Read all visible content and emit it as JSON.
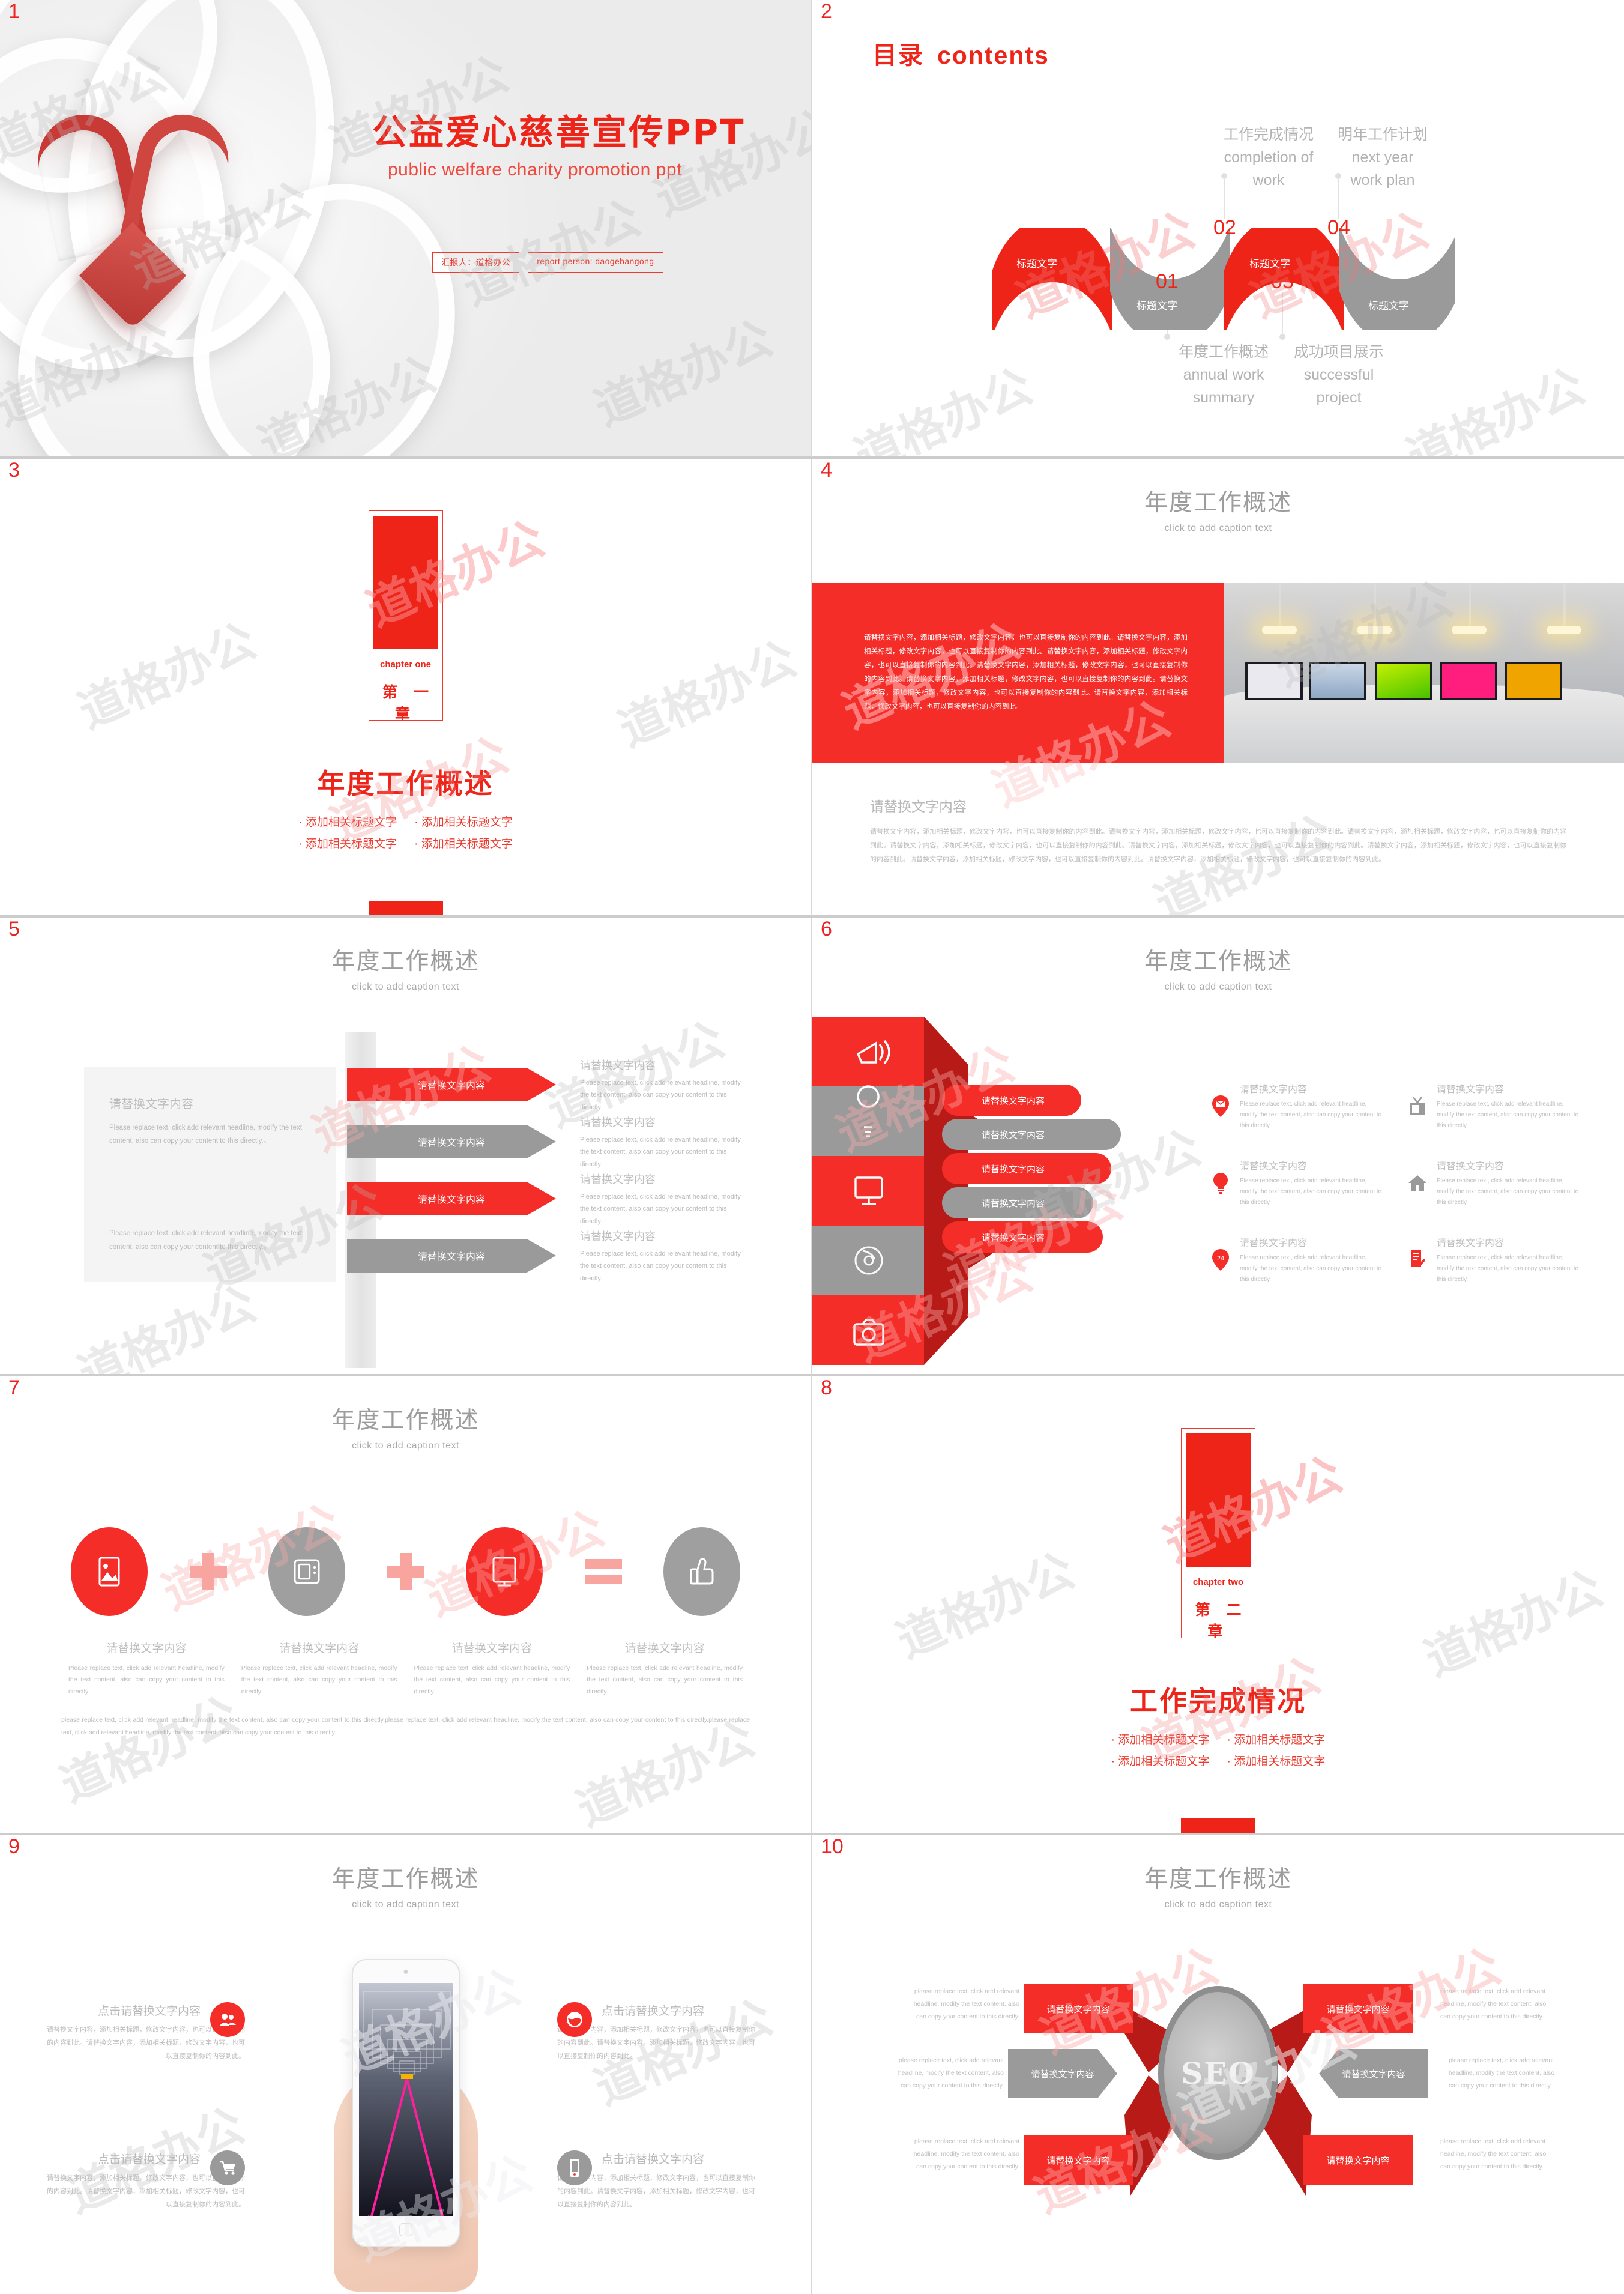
{
  "theme": {
    "red": "#f52d28",
    "red_dark": "#ee2419",
    "gray": "#9a9a9a",
    "light_gray": "#bfbfbf"
  },
  "watermark": "道格办公",
  "slides": [
    {
      "num": "1",
      "title_cn": "公益爱心慈善宣传PPT",
      "title_en": "public welfare charity promotion ppt",
      "badge_cn": "汇报人：道格办公",
      "badge_en": "report person: daogebangong"
    },
    {
      "num": "2",
      "title_cn": "目录",
      "title_en": "contents",
      "segments": [
        {
          "number": "01",
          "ribbon_label": "标题文字",
          "title_cn": "年度工作概述",
          "title_en_1": "annual work",
          "title_en_2": "summary",
          "color": "red",
          "pos": "down"
        },
        {
          "number": "02",
          "ribbon_label": "标题文字",
          "title_cn": "工作完成情况",
          "title_en_1": "completion of",
          "title_en_2": "work",
          "color": "gray",
          "pos": "up"
        },
        {
          "number": "03",
          "ribbon_label": "标题文字",
          "title_cn": "成功项目展示",
          "title_en_1": "successful",
          "title_en_2": "project",
          "color": "red",
          "pos": "down"
        },
        {
          "number": "04",
          "ribbon_label": "标题文字",
          "title_cn": "明年工作计划",
          "title_en_1": "next year",
          "title_en_2": "work plan",
          "color": "gray",
          "pos": "up"
        }
      ]
    },
    {
      "num": "3",
      "chapter_en": "chapter one",
      "chapter_cn": "第 一 章",
      "heading": "年度工作概述",
      "bullets": [
        "添加相关标题文字",
        "添加相关标题文字",
        "添加相关标题文字",
        "添加相关标题文字"
      ]
    },
    {
      "num": "4",
      "header_cn": "年度工作概述",
      "header_en": "click to add caption text",
      "red_body": "请替换文字内容，添加相关标题，修改文字内容，也可以直接复制你的内容到此。请替换文字内容，添加相关标题，修改文字内容，也可以直接复制你的内容到此。请替换文字内容，添加相关标题，修改文字内容，也可以直接复制你的内容到此。请替换文字内容，添加相关标题，修改文字内容，也可以直接复制你的内容到此。请替换文字内容，添加相关标题，修改文字内容，也可以直接复制你的内容到此。请替换文字内容，添加相关标题，修改文字内容，也可以直接复制你的内容到此。请替换文字内容，添加相关标题，修改文字内容，也可以直接复制你的内容到此。",
      "foot_title": "请替换文字内容",
      "foot_body": "请替换文字内容，添加相关标题，修改文字内容，也可以直接复制你的内容到此。请替换文字内容，添加相关标题，修改文字内容，也可以直接复制你的内容到此。请替换文字内容，添加相关标题，修改文字内容，也可以直接复制你的内容到此。请替换文字内容，添加相关标题，修改文字内容，也可以直接复制你的内容到此。请替换文字内容，添加相关标题，修改文字内容，也可以直接复制你的内容到此。请替换文字内容，添加相关标题，修改文字内容，也可以直接复制你的内容到此。请替换文字内容，添加相关标题，修改文字内容，也可以直接复制你的内容到此。请替换文字内容，添加相关标题，修改文字内容，也可以直接复制你的内容到此。"
    },
    {
      "num": "5",
      "header_cn": "年度工作概述",
      "header_en": "click to add caption text",
      "card_title": "请替换文字内容",
      "card_body_top": "Please replace text, click add relevant headline, modify the text content, also can copy your content to this directly.。",
      "card_body_bottom": "Please replace text, click add relevant headline, modify the text content, also can copy your content to this directly.。",
      "arrows": [
        {
          "label": "请替换文字内容",
          "color": "red"
        },
        {
          "label": "请替换文字内容",
          "color": "gray"
        },
        {
          "label": "请替换文字内容",
          "color": "red"
        },
        {
          "label": "请替换文字内容",
          "color": "gray"
        }
      ],
      "details": [
        {
          "title": "请替换文字内容",
          "body": "Please replace text, click add relevant headline, modify the text content, also can copy your content to this directly."
        },
        {
          "title": "请替换文字内容",
          "body": "Please replace text, click add relevant headline, modify the text content, also can copy your content to this directly."
        },
        {
          "title": "请替换文字内容",
          "body": "Please replace text, click add relevant headline, modify the text content, also can copy your content to this directly."
        },
        {
          "title": "请替换文字内容",
          "body": "Please replace text, click add relevant headline, modify the text content, also can copy your content to this directly."
        }
      ]
    },
    {
      "num": "6",
      "header_cn": "年度工作概述",
      "header_en": "click to add caption text",
      "funnel_icons": [
        "megaphone-icon",
        "lightbulb-icon",
        "monitor-icon",
        "disc-icon",
        "camera-icon"
      ],
      "pills": [
        {
          "label": "请替换文字内容",
          "color": "red"
        },
        {
          "label": "请替换文字内容",
          "color": "gray"
        },
        {
          "label": "请替换文字内容",
          "color": "red"
        },
        {
          "label": "请替换文字内容",
          "color": "gray"
        },
        {
          "label": "请替换文字内容",
          "color": "red"
        }
      ],
      "items": [
        {
          "icon": "envelope-pin-icon",
          "color": "red",
          "title": "请替换文字内容",
          "body": "Please replace text, click add relevant headline, modify the text content, also can copy your content to this directly."
        },
        {
          "icon": "tv-icon",
          "color": "gray",
          "title": "请替换文字内容",
          "body": "Please replace text, click add relevant headline, modify the text content, also can copy your content to this directly."
        },
        {
          "icon": "lightbulb-icon",
          "color": "red",
          "title": "请替换文字内容",
          "body": "Please replace text, click add relevant headline, modify the text content, also can copy your content to this directly."
        },
        {
          "icon": "house-icon",
          "color": "gray",
          "title": "请替换文字内容",
          "body": "Please replace text, click add relevant headline, modify the text content, also can copy your content to this directly."
        },
        {
          "icon": "phone-24-icon",
          "color": "red",
          "title": "请替换文字内容",
          "body": "Please replace text, click add relevant headline, modify the text content, also can copy your content to this directly."
        },
        {
          "icon": "document-pen-icon",
          "color": "red",
          "title": "请替换文字内容",
          "body": "Please replace text, click add relevant headline, modify the text content, also can copy your content to this directly."
        }
      ]
    },
    {
      "num": "7",
      "header_cn": "年度工作概述",
      "header_en": "click to add caption text",
      "nodes": [
        {
          "icon": "image-icon",
          "color": "red"
        },
        {
          "icon": "tv-icon",
          "color": "gray"
        },
        {
          "icon": "tablet-icon",
          "color": "red"
        },
        {
          "icon": "thumbs-up-icon",
          "color": "gray"
        }
      ],
      "operators": [
        "plus",
        "plus",
        "equals"
      ],
      "captions": [
        {
          "title": "请替换文字内容",
          "body": "Please replace text, click add relevant headline, modify the text content, also can copy your content to this directly."
        },
        {
          "title": "请替换文字内容",
          "body": "Please replace text, click add relevant headline, modify the text content, also can copy your content to this directly."
        },
        {
          "title": "请替换文字内容",
          "body": "Please replace text, click add relevant headline, modify the text content, also can copy your content to this directly."
        },
        {
          "title": "请替换文字内容",
          "body": "Please replace text, click add relevant headline, modify the text content, also can copy your content to this directly."
        }
      ],
      "footer": "please replace text, click add relevant headline, modify the text content, also can copy your content to this directly.please replace text, click add relevant headline, modify the text content, also can copy your content to this directly.please replace text, click add relevant headline, modify the text content, also can copy your content to this directly."
    },
    {
      "num": "8",
      "chapter_en": "chapter two",
      "chapter_cn": "第 二 章",
      "heading": "工作完成情况",
      "bullets": [
        "添加相关标题文字",
        "添加相关标题文字",
        "添加相关标题文字",
        "添加相关标题文字"
      ]
    },
    {
      "num": "9",
      "header_cn": "年度工作概述",
      "header_en": "click to add caption text",
      "cells": [
        {
          "icon": "users-icon",
          "color": "red",
          "title": "点击请替换文字内容",
          "body": "请替换文字内容，添加相关标题，修改文字内容，也可以直接复制你的内容到此。请替换文字内容，添加相关标题，修改文字内容，也可以直接复制你的内容到此。"
        },
        {
          "icon": "globe-icon",
          "color": "red",
          "title": "点击请替换文字内容",
          "body": "请替换文字内容，添加相关标题，修改文字内容，也可以直接复制你的内容到此。请替换文字内容，添加相关标题，修改文字内容，也可以直接复制你的内容到此。"
        },
        {
          "icon": "cart-icon",
          "color": "gray",
          "title": "点击请替换文字内容",
          "body": "请替换文字内容，添加相关标题，修改文字内容，也可以直接复制你的内容到此。请替换文字内容，添加相关标题，修改文字内容，也可以直接复制你的内容到此。"
        },
        {
          "icon": "mobile-icon",
          "color": "gray",
          "title": "点击请替换文字内容",
          "body": "请替换文字内容，添加相关标题，修改文字内容，也可以直接复制你的内容到此。请替换文字内容，添加相关标题，修改文字内容，也可以直接复制你的内容到此。"
        }
      ]
    },
    {
      "num": "10",
      "header_cn": "年度工作概述",
      "header_en": "click to add caption text",
      "hub_label": "SEO",
      "branches": [
        {
          "label": "请替换文字内容",
          "color": "red",
          "body": "please replace text, click add relevant headline, modify the text content, also can copy your content to this directly."
        },
        {
          "label": "请替换文字内容",
          "color": "red",
          "body": "please replace text, click add relevant headline, modify the text content, also can copy your content to this directly."
        },
        {
          "label": "请替换文字内容",
          "color": "gray",
          "body": "please replace text, click add relevant headline, modify the text content, also can copy your content to this directly."
        },
        {
          "label": "请替换文字内容",
          "color": "gray",
          "body": "please replace text, click add relevant headline, modify the text content, also can copy your content to this directly."
        },
        {
          "label": "请替换文字内容",
          "color": "red",
          "body": "please replace text, click add relevant headline, modify the text content, also can copy your content to this directly."
        },
        {
          "label": "请替换文字内容",
          "color": "red",
          "body": "please replace text, click add relevant headline, modify the text content, also can copy your content to this directly."
        }
      ]
    }
  ]
}
